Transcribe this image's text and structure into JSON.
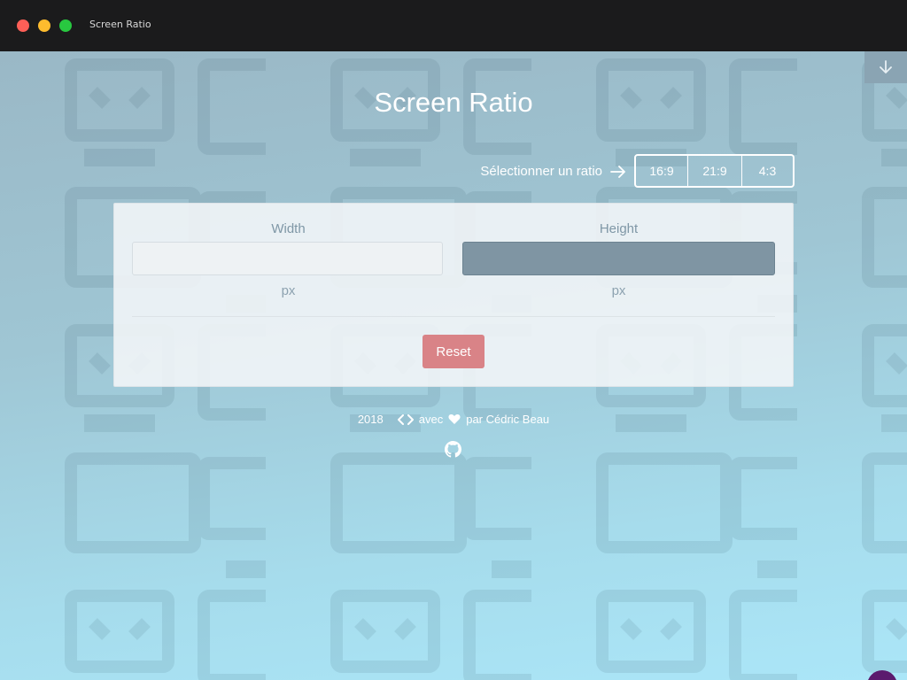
{
  "window": {
    "title": "Screen Ratio"
  },
  "page": {
    "title": "Screen Ratio"
  },
  "ratio_selector": {
    "label": "Sélectionner un ratio",
    "options": [
      "16:9",
      "21:9",
      "4:3"
    ]
  },
  "form": {
    "width_label": "Width",
    "height_label": "Height",
    "width_value": "",
    "height_value": "",
    "width_unit": "px",
    "height_unit": "px",
    "reset_label": "Reset"
  },
  "footer": {
    "year": "2018",
    "avec": "avec",
    "par": "par Cédric Beau"
  },
  "icons": {
    "download": "arrow-down-icon",
    "ratio_arrow": "arrow-right-icon",
    "code": "code-icon",
    "heart": "heart-icon",
    "github": "github-icon"
  },
  "colors": {
    "reset_button": "#d98387",
    "height_input": "#7f95a3",
    "titlebar": "#1b1b1c"
  }
}
